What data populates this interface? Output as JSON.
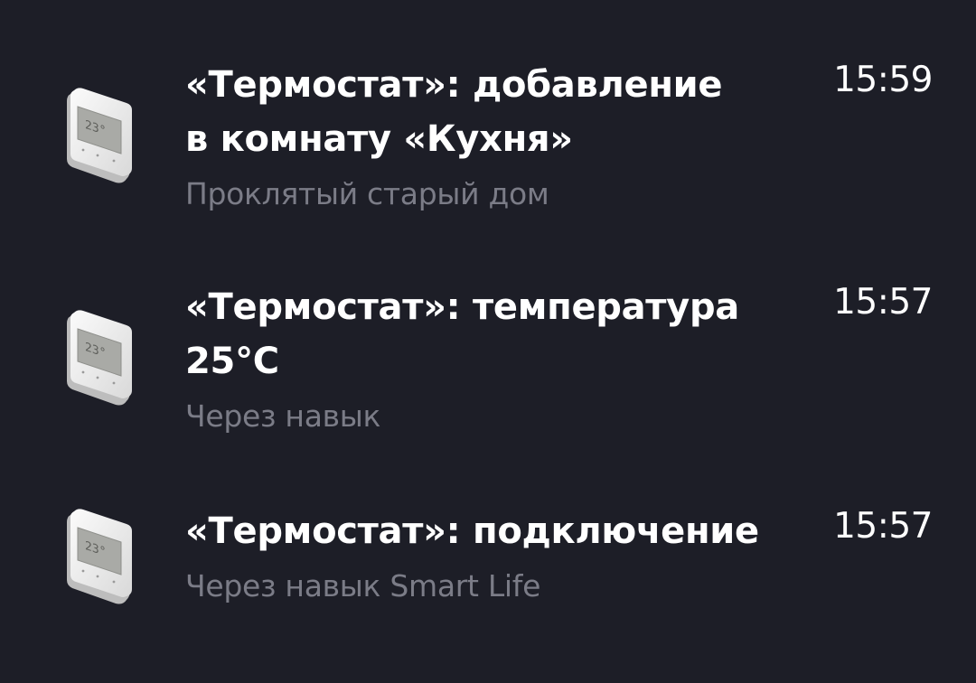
{
  "notifications": [
    {
      "icon": "thermostat-icon",
      "display": "23°",
      "title_line1": "«Термостат»: добавление",
      "title_line2": "в комнату «Кухня»",
      "subtitle": "Проклятый старый дом",
      "time": "15:59"
    },
    {
      "icon": "thermostat-icon",
      "display": "23°",
      "title_line1": "«Термостат»: температура",
      "title_line2": "25°C",
      "subtitle": "Через навык",
      "time": "15:57"
    },
    {
      "icon": "thermostat-icon",
      "display": "23°",
      "title_line1": "«Термостат»: подключение",
      "subtitle": "Через навык Smart Life",
      "time": "15:57"
    }
  ],
  "colors": {
    "background": "#1d1e27",
    "title": "#ffffff",
    "subtitle": "#7b7c87"
  }
}
